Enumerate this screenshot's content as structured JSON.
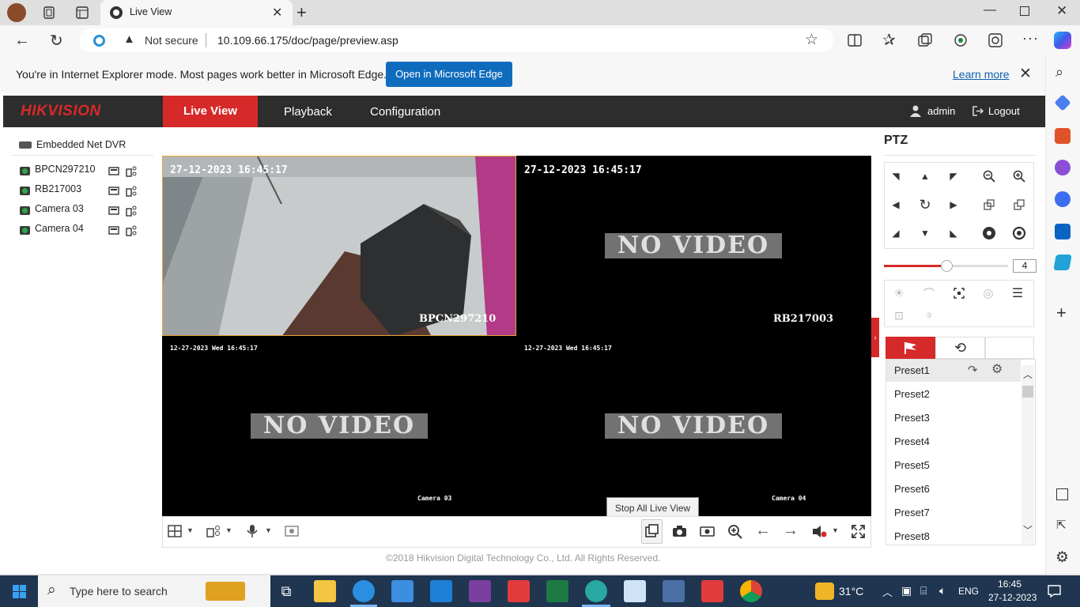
{
  "browser": {
    "tab_title": "Live View",
    "security_label": "Not secure",
    "url": "10.109.66.175/doc/page/preview.asp",
    "ie_message": "You're in Internet Explorer mode. Most pages work better in Microsoft Edge.",
    "open_edge_button": "Open in Microsoft Edge",
    "learn_more_link": "Learn more"
  },
  "header": {
    "logo": "HIKVISION",
    "nav": [
      "Live View",
      "Playback",
      "Configuration"
    ],
    "active_nav": "Live View",
    "user": "admin",
    "logout": "Logout"
  },
  "device_tree": {
    "root": "Embedded Net DVR",
    "cameras": [
      "BPCN297210",
      "RB217003",
      "Camera 03",
      "Camera 04"
    ]
  },
  "channels": [
    {
      "timestamp": "27-12-2023 16:45:17",
      "label": "BPCN297210",
      "status": "",
      "selected": true
    },
    {
      "timestamp": "27-12-2023 16:45:17",
      "label": "RB217003",
      "status": "NO VIDEO"
    },
    {
      "timestamp": "12-27-2023 Wed 16:45:17",
      "label": "Camera 03",
      "status": "NO VIDEO"
    },
    {
      "timestamp": "12-27-2023 Wed 16:45:17",
      "label": "Camera 04",
      "status": "NO VIDEO"
    }
  ],
  "tooltip": "Stop All Live View",
  "footer": "©2018 Hikvision Digital Technology Co., Ltd. All Rights Reserved.",
  "ptz": {
    "title": "PTZ",
    "speed": "4",
    "speed_fraction": 0.5,
    "presets": [
      "Preset1",
      "Preset2",
      "Preset3",
      "Preset4",
      "Preset5",
      "Preset6",
      "Preset7",
      "Preset8"
    ]
  },
  "taskbar": {
    "search_placeholder": "Type here to search",
    "weather": "31°C",
    "language": "ENG",
    "time": "16:45",
    "date": "27-12-2023"
  },
  "colors": {
    "hik_red": "#d62929",
    "nav_dark": "#2d2d2d",
    "edge_blue": "#0f6cbd",
    "selected_border": "#e8a735",
    "taskbar": "#1f3550"
  }
}
